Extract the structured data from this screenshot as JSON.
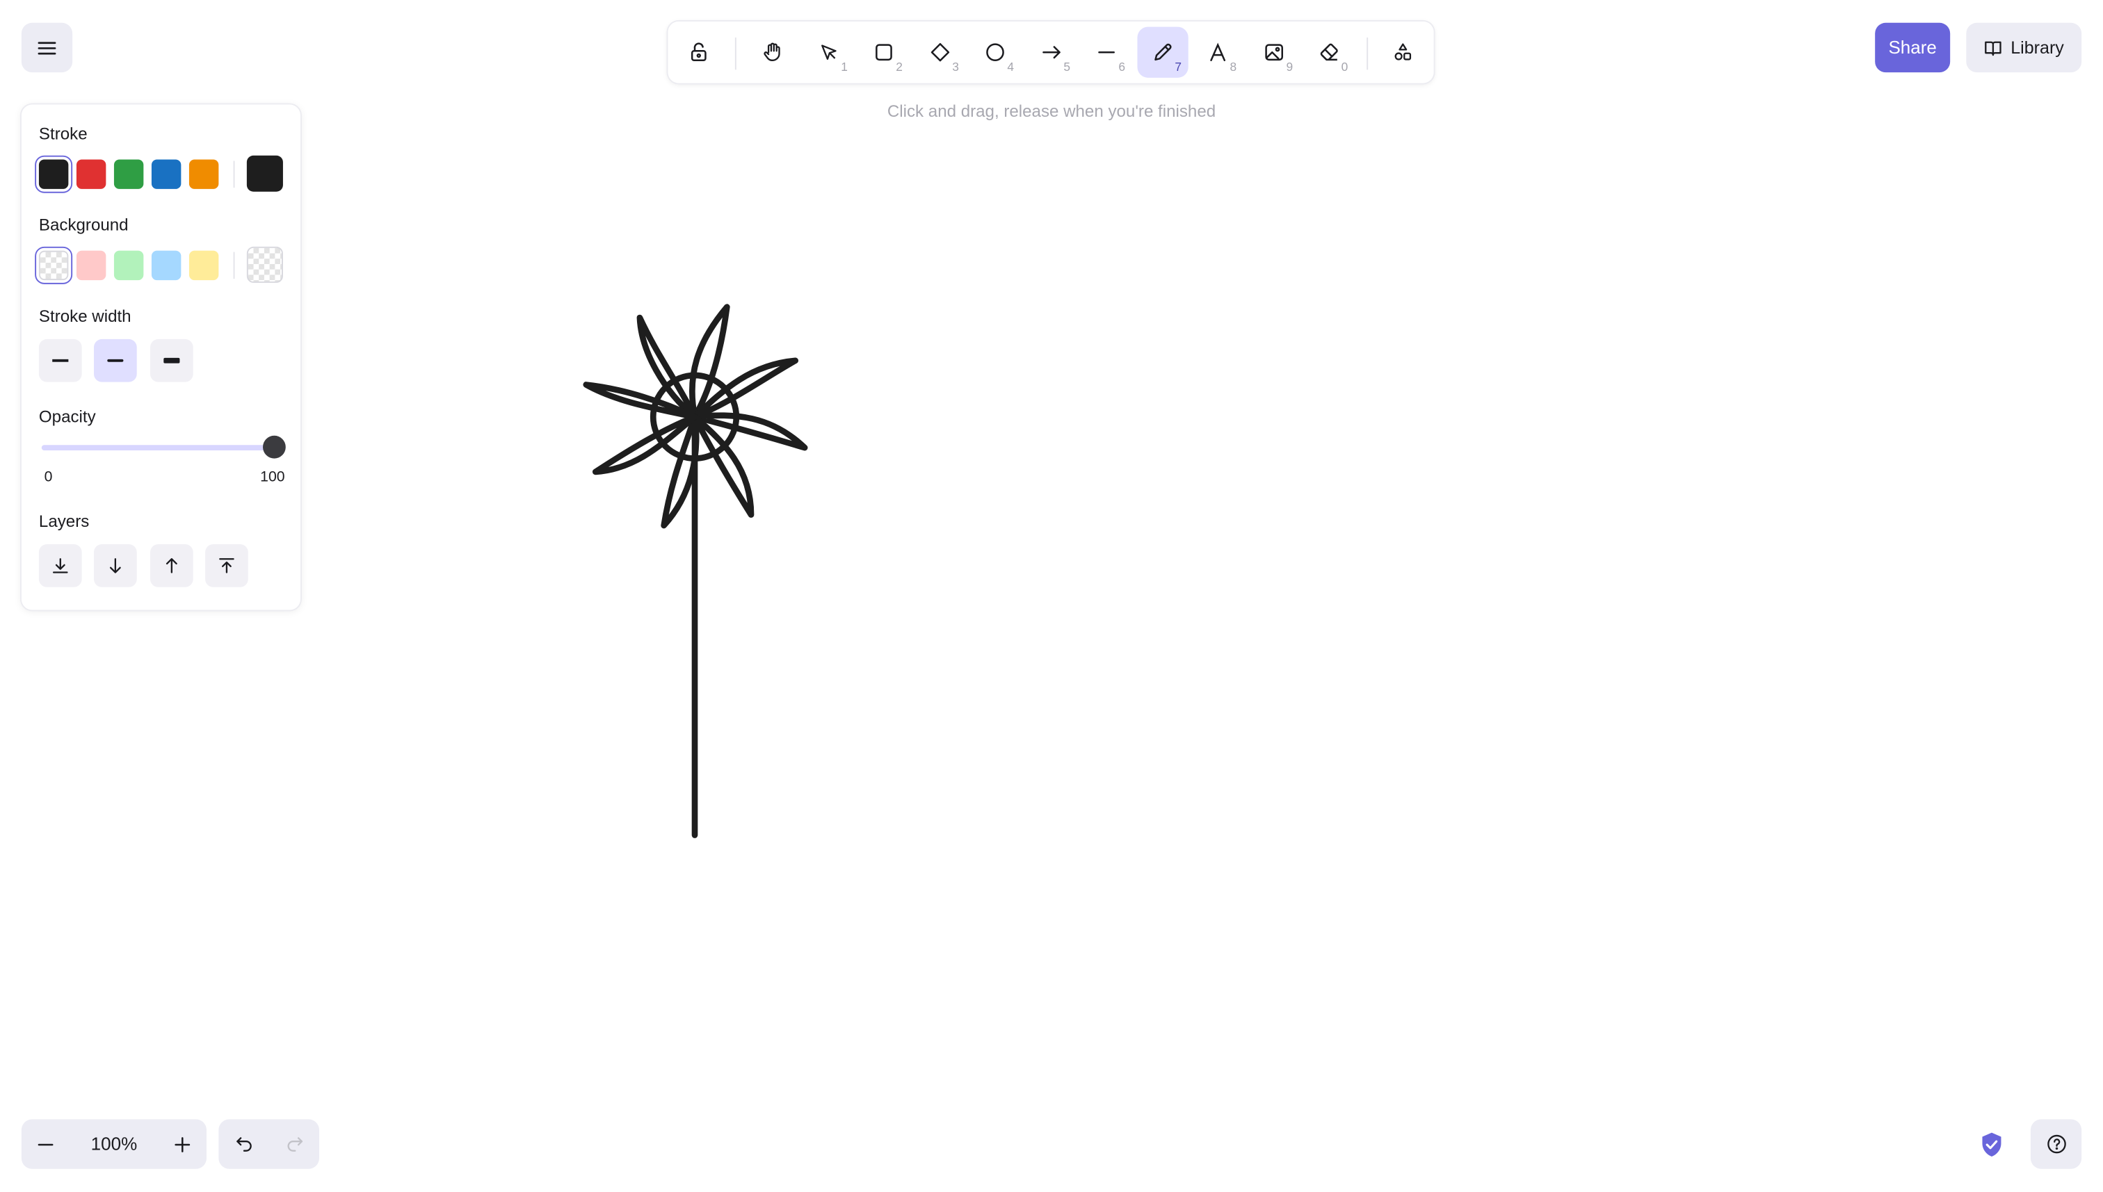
{
  "app": {
    "menu_icon": "hamburger-menu-icon"
  },
  "toolbar": {
    "tools": [
      {
        "name": "lock",
        "icon": "lock-open-icon",
        "key": ""
      },
      {
        "name": "hand",
        "icon": "hand-icon",
        "key": ""
      },
      {
        "name": "selection",
        "icon": "pointer-icon",
        "key": "1"
      },
      {
        "name": "rectangle",
        "icon": "rectangle-icon",
        "key": "2"
      },
      {
        "name": "diamond",
        "icon": "diamond-icon",
        "key": "3"
      },
      {
        "name": "ellipse",
        "icon": "ellipse-icon",
        "key": "4"
      },
      {
        "name": "arrow",
        "icon": "arrow-icon",
        "key": "5"
      },
      {
        "name": "line",
        "icon": "line-icon",
        "key": "6"
      },
      {
        "name": "draw",
        "icon": "pencil-icon",
        "key": "7",
        "active": true
      },
      {
        "name": "text",
        "icon": "text-icon",
        "key": "8"
      },
      {
        "name": "image",
        "icon": "image-icon",
        "key": "9"
      },
      {
        "name": "eraser",
        "icon": "eraser-icon",
        "key": "0"
      },
      {
        "name": "extra-tools",
        "icon": "shapes-icon",
        "key": ""
      }
    ],
    "hint": "Click and drag, release when you're finished"
  },
  "panel": {
    "stroke_label": "Stroke",
    "stroke_colors": [
      "#1e1e1e",
      "#e03131",
      "#2f9e44",
      "#1971c2",
      "#f08c00"
    ],
    "stroke_selected": "#1e1e1e",
    "background_label": "Background",
    "background_colors": [
      "transparent",
      "#ffc9c9",
      "#b2f2bb",
      "#a5d8ff",
      "#ffec99"
    ],
    "background_selected": "transparent",
    "stroke_width_label": "Stroke width",
    "stroke_width_options": [
      "thin",
      "bold",
      "extra-bold"
    ],
    "stroke_width_selected": "bold",
    "opacity_label": "Opacity",
    "opacity_min": "0",
    "opacity_max": "100",
    "opacity_value": 100,
    "layers_label": "Layers"
  },
  "header": {
    "share_label": "Share",
    "library_label": "Library"
  },
  "footer": {
    "zoom_value": "100%"
  },
  "colors": {
    "accent": "#6965db",
    "accent_light": "#e0dfff",
    "island_bg": "#ececf4"
  }
}
